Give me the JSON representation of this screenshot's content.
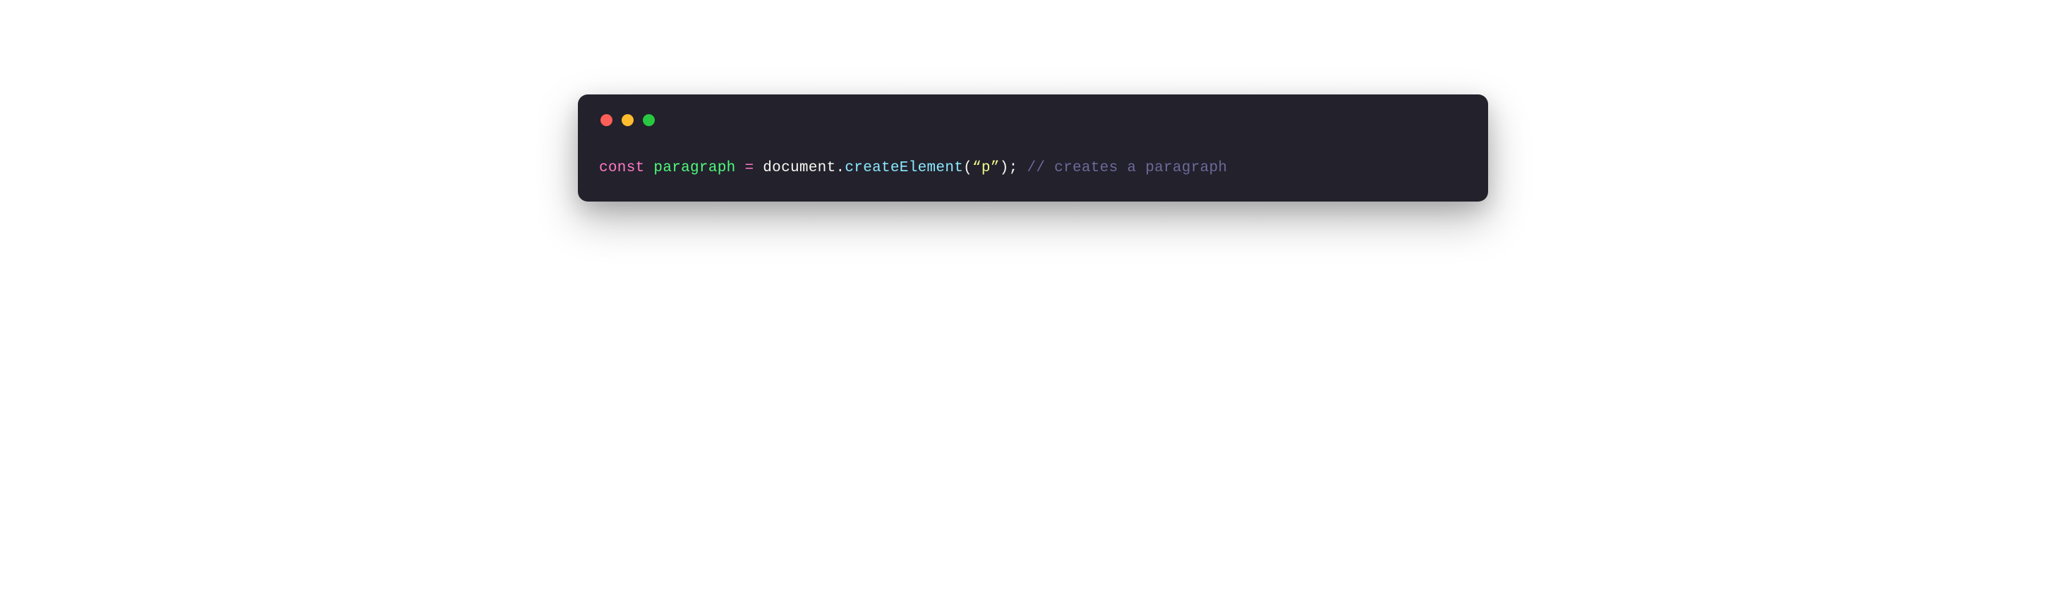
{
  "window": {
    "traffic_lights": [
      "red",
      "yellow",
      "green"
    ]
  },
  "code": {
    "tokens": {
      "keyword": "const",
      "sp1": " ",
      "variable": "paragraph",
      "sp2": " ",
      "operator": "=",
      "sp3": " ",
      "object": "document",
      "dot": ".",
      "method": "createElement",
      "lparen": "(",
      "string": "“p”",
      "rparen": ")",
      "semicolon": ";",
      "sp4": " ",
      "comment": "// creates a paragraph"
    }
  }
}
